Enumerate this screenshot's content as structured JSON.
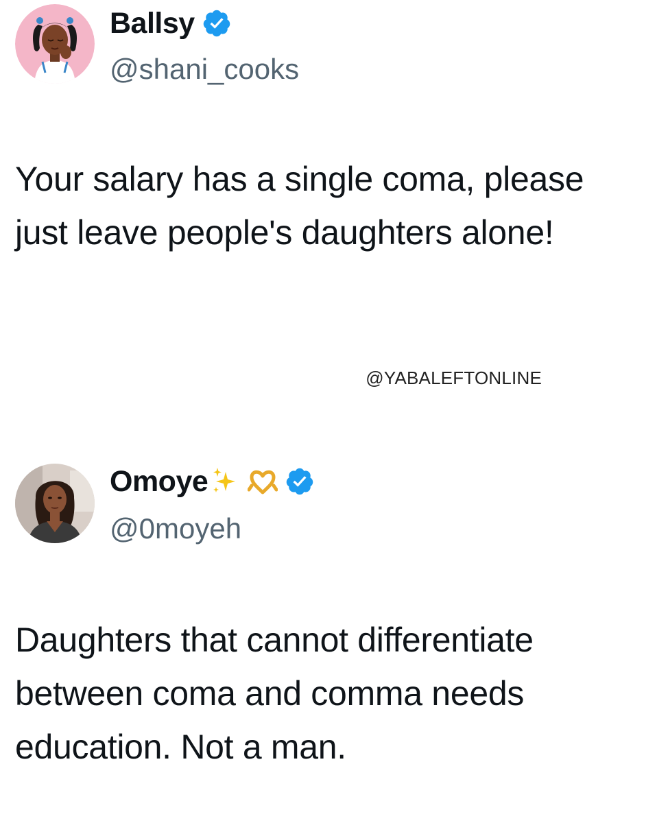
{
  "colors": {
    "verified_blue": "#1d9bf0",
    "handle_grey": "#536471",
    "text_dark": "#0f1419",
    "avatar1_bg": "#f4b6c8"
  },
  "tweets": [
    {
      "display_name": "Ballsy",
      "handle": "@shani_cooks",
      "verified_icon": "verified-badge-icon",
      "avatar_icon": "avatar-cartoon-woman",
      "text": "Your salary has a single coma, please just leave people's daughters alone!"
    },
    {
      "display_name": "Omoye",
      "name_emojis": [
        "sparkles-icon",
        "heart-hands-icon"
      ],
      "handle": "@0moyeh",
      "verified_icon": "verified-badge-icon",
      "avatar_icon": "avatar-photo-woman",
      "text": "Daughters that cannot differentiate between coma and comma needs education. Not a man."
    }
  ],
  "watermark": "@YABALEFTONLINE"
}
